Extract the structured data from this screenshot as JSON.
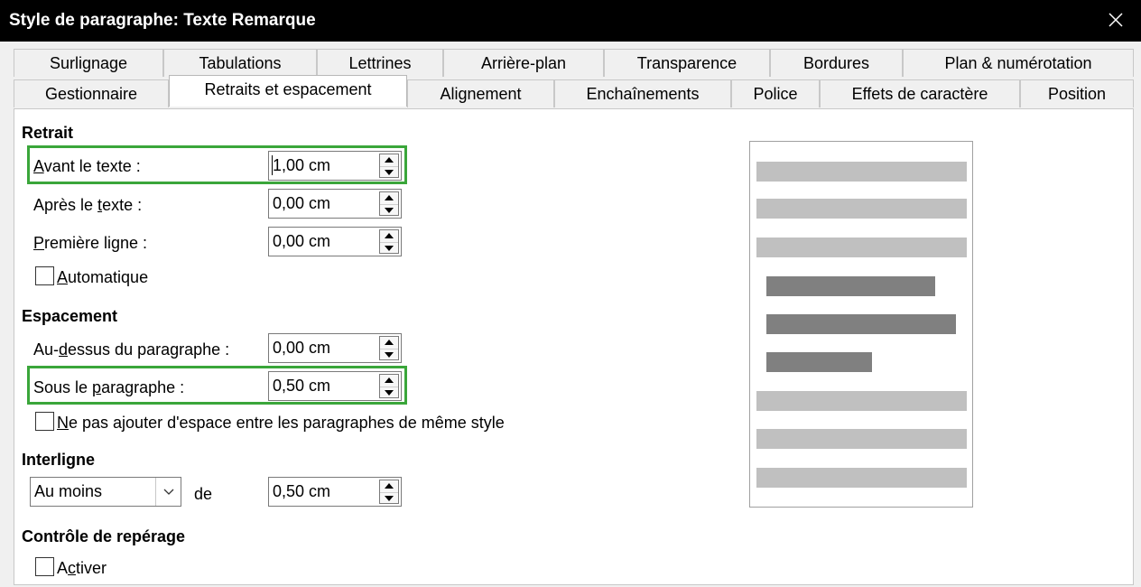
{
  "window": {
    "title": "Style de paragraphe: Texte Remarque"
  },
  "tabs_row1": [
    "Surlignage",
    "Tabulations",
    "Lettrines",
    "Arrière-plan",
    "Transparence",
    "Bordures",
    "Plan & numérotation"
  ],
  "tabs_row2": [
    "Gestionnaire",
    "Retraits et espacement",
    "Alignement",
    "Enchaînements",
    "Police",
    "Effets de caractère",
    "Position"
  ],
  "active_tab": "Retraits et espacement",
  "retrait": {
    "heading": "Retrait",
    "avant_label_u": "A",
    "avant_label_rest": "vant le texte :",
    "avant_value": "1,00 cm",
    "apres_label_pre": "Après le ",
    "apres_label_u": "t",
    "apres_label_rest": "exte :",
    "apres_value": "0,00 cm",
    "premiere_label_u": "P",
    "premiere_label_rest": "remière ligne :",
    "premiere_value": "0,00 cm",
    "auto_label_u": "A",
    "auto_label_rest": "utomatique",
    "auto_checked": false
  },
  "espacement": {
    "heading": "Espacement",
    "dessus_label_pre": "Au-",
    "dessus_label_u": "d",
    "dessus_label_rest": "essus du paragraphe :",
    "dessus_value": "0,00 cm",
    "sous_label_pre": "Sous le ",
    "sous_label_u": "p",
    "sous_label_rest": "aragraphe :",
    "sous_value": "0,50 cm",
    "noadd_label_u": "N",
    "noadd_label_rest": "e pas ajouter d'espace entre les paragraphes de même style",
    "noadd_checked": false
  },
  "interligne": {
    "heading": "Interligne",
    "select_value": "Au moins",
    "de_label": "de",
    "value": "0,50 cm"
  },
  "reperage": {
    "heading": "Contrôle de repérage",
    "activer_label_pre": "A",
    "activer_label_u": "c",
    "activer_label_rest": "tiver",
    "activer_checked": false
  },
  "colors": {
    "highlight": "#3aa63a",
    "preview_light": "#c0c0c0",
    "preview_dark": "#808080"
  }
}
